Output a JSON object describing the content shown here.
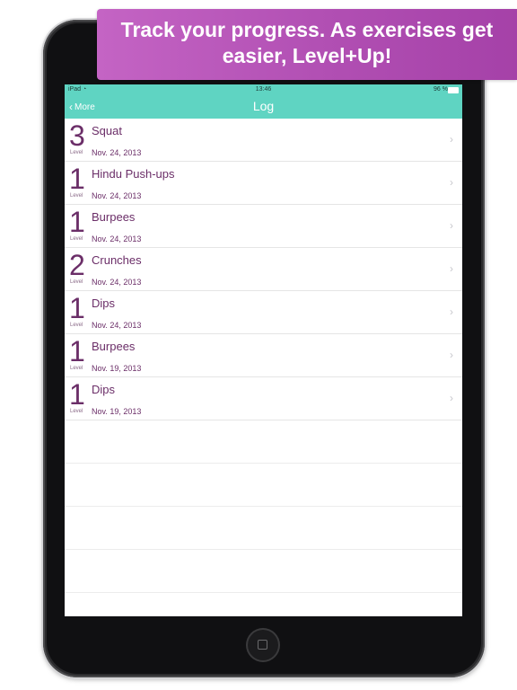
{
  "banner": {
    "line1": "Track your progress. As exercises get",
    "line2": "easier, Level+Up!"
  },
  "status_bar": {
    "carrier": "iPad",
    "wifi_icon": "wifi-icon",
    "time": "13:46",
    "battery": "96 %",
    "battery_icon": "battery-icon"
  },
  "nav": {
    "back_label": "More",
    "title": "Log",
    "color": "#5fd4c2"
  },
  "accent_color": "#6b2e68",
  "level_caption": "Level",
  "log": [
    {
      "level": "3",
      "exercise": "Squat",
      "date": "Nov. 24, 2013"
    },
    {
      "level": "1",
      "exercise": "Hindu Push-ups",
      "date": "Nov. 24, 2013"
    },
    {
      "level": "1",
      "exercise": "Burpees",
      "date": "Nov. 24, 2013"
    },
    {
      "level": "2",
      "exercise": "Crunches",
      "date": "Nov. 24, 2013"
    },
    {
      "level": "1",
      "exercise": "Dips",
      "date": "Nov. 24, 2013"
    },
    {
      "level": "1",
      "exercise": "Burpees",
      "date": "Nov. 19, 2013"
    },
    {
      "level": "1",
      "exercise": "Dips",
      "date": "Nov. 19, 2013"
    }
  ]
}
